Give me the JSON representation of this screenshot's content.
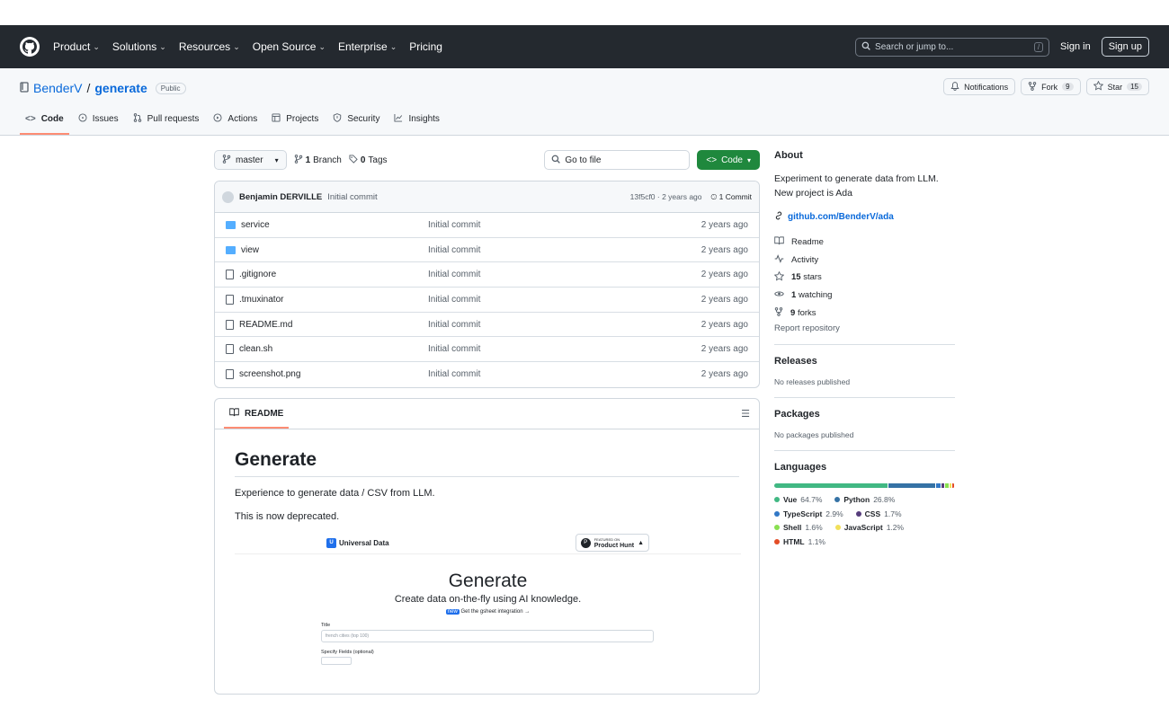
{
  "header": {
    "nav": [
      {
        "label": "Product",
        "chev": true
      },
      {
        "label": "Solutions",
        "chev": true
      },
      {
        "label": "Resources",
        "chev": true
      },
      {
        "label": "Open Source",
        "chev": true
      },
      {
        "label": "Enterprise",
        "chev": true
      },
      {
        "label": "Pricing",
        "chev": false
      }
    ],
    "search_placeholder": "Search or jump to...",
    "search_key": "/",
    "signin": "Sign in",
    "signup": "Sign up"
  },
  "repo": {
    "owner": "BenderV",
    "sep": "/",
    "name": "generate",
    "visibility": "Public",
    "notifications": "Notifications",
    "fork_label": "Fork",
    "fork_count": "9",
    "star_label": "Star",
    "star_count": "15"
  },
  "tabs": [
    "Code",
    "Issues",
    "Pull requests",
    "Actions",
    "Projects",
    "Security",
    "Insights"
  ],
  "toolbar": {
    "branch": "master",
    "branches_count": "1",
    "branches_label": "Branch",
    "tags_count": "0",
    "tags_label": "Tags",
    "goto_file": "Go to file",
    "code_button": "Code"
  },
  "commit": {
    "author": "Benjamin DERVILLE",
    "message": "Initial commit",
    "hash": "13f5cf0 · 2 years ago",
    "count": "1 Commit"
  },
  "files": [
    {
      "name": "service",
      "type": "dir",
      "msg": "Initial commit",
      "time": "2 years ago"
    },
    {
      "name": "view",
      "type": "dir",
      "msg": "Initial commit",
      "time": "2 years ago"
    },
    {
      "name": ".gitignore",
      "type": "file",
      "msg": "Initial commit",
      "time": "2 years ago"
    },
    {
      "name": ".tmuxinator",
      "type": "file",
      "msg": "Initial commit",
      "time": "2 years ago"
    },
    {
      "name": "README.md",
      "type": "file",
      "msg": "Initial commit",
      "time": "2 years ago"
    },
    {
      "name": "clean.sh",
      "type": "file",
      "msg": "Initial commit",
      "time": "2 years ago"
    },
    {
      "name": "screenshot.png",
      "type": "file",
      "msg": "Initial commit",
      "time": "2 years ago"
    }
  ],
  "readme": {
    "tab": "README",
    "title": "Generate",
    "p1": "Experience to generate data / CSV from LLM.",
    "p2": "This is now deprecated.",
    "shot": {
      "brand": "Universal Data",
      "ph_small": "FEATURED ON",
      "ph_name": "Product Hunt",
      "title": "Generate",
      "subtitle": "Create data on-the-fly using AI knowledge.",
      "integration": "Get the gsheet integration →",
      "label1": "Title",
      "input_placeholder": "french cities (top 100)",
      "label2": "Specify Fields (optional)"
    }
  },
  "sidebar": {
    "about_title": "About",
    "description": "Experiment to generate data from LLM. New project is Ada",
    "link": "github.com/BenderV/ada",
    "readme": "Readme",
    "activity": "Activity",
    "stars_count": "15",
    "stars_label": "stars",
    "watching_count": "1",
    "watching_label": "watching",
    "forks_count": "9",
    "forks_label": "forks",
    "report": "Report repository",
    "releases_title": "Releases",
    "releases_empty": "No releases published",
    "packages_title": "Packages",
    "packages_empty": "No packages published",
    "languages_title": "Languages",
    "languages": [
      {
        "name": "Vue",
        "pct": "64.7%",
        "value": 64.7,
        "color": "#41b883"
      },
      {
        "name": "Python",
        "pct": "26.8%",
        "value": 26.8,
        "color": "#3572a5"
      },
      {
        "name": "TypeScript",
        "pct": "2.9%",
        "value": 2.9,
        "color": "#3178c6"
      },
      {
        "name": "CSS",
        "pct": "1.7%",
        "value": 1.7,
        "color": "#563d7c"
      },
      {
        "name": "Shell",
        "pct": "1.6%",
        "value": 1.6,
        "color": "#89e051"
      },
      {
        "name": "JavaScript",
        "pct": "1.2%",
        "value": 1.2,
        "color": "#f1e05a"
      },
      {
        "name": "HTML",
        "pct": "1.1%",
        "value": 1.1,
        "color": "#e34c26"
      }
    ]
  }
}
